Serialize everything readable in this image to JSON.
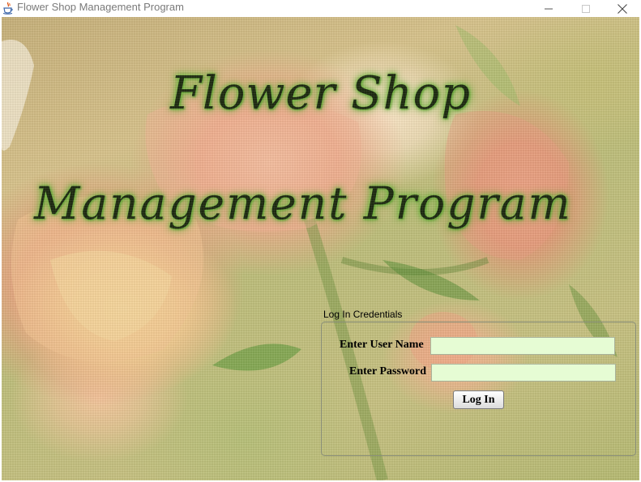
{
  "window": {
    "title": "Flower Shop Management Program",
    "icon": "java-coffee-cup-icon",
    "controls": {
      "minimize_icon": "minimize-icon",
      "maximize_icon": "maximize-icon",
      "close_icon": "close-icon"
    }
  },
  "hero": {
    "line1": "Flower Shop",
    "line2": "Management Program"
  },
  "login": {
    "group_title": "Log In Credentials",
    "username_label": "Enter User Name",
    "username_value": "",
    "password_label": "Enter Password",
    "password_value": "",
    "submit_label": "Log In"
  },
  "colors": {
    "input_background": "#e6fcd4",
    "title_glow": "#6fb63c",
    "title_text": "#1d2a10"
  }
}
